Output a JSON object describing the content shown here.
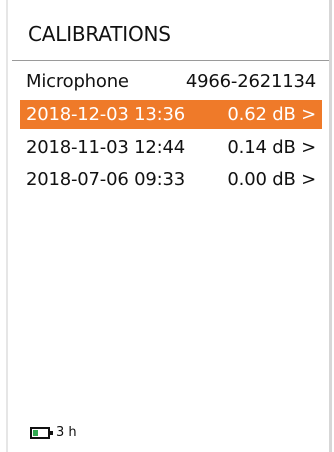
{
  "title": "CALIBRATIONS",
  "header": {
    "label": "Microphone",
    "value": "4966-2621134"
  },
  "calibrations": [
    {
      "datetime": "2018-12-03 13:36",
      "value": "0.62 dB >",
      "selected": true
    },
    {
      "datetime": "2018-11-03 12:44",
      "value": "0.14 dB >",
      "selected": false
    },
    {
      "datetime": "2018-07-06 09:33",
      "value": "0.00 dB >",
      "selected": false
    }
  ],
  "status": {
    "battery_level": 0.35,
    "battery_time": "3 h"
  },
  "colors": {
    "selected_row": "#ef7a29",
    "battery_fill": "#2fa84f"
  }
}
